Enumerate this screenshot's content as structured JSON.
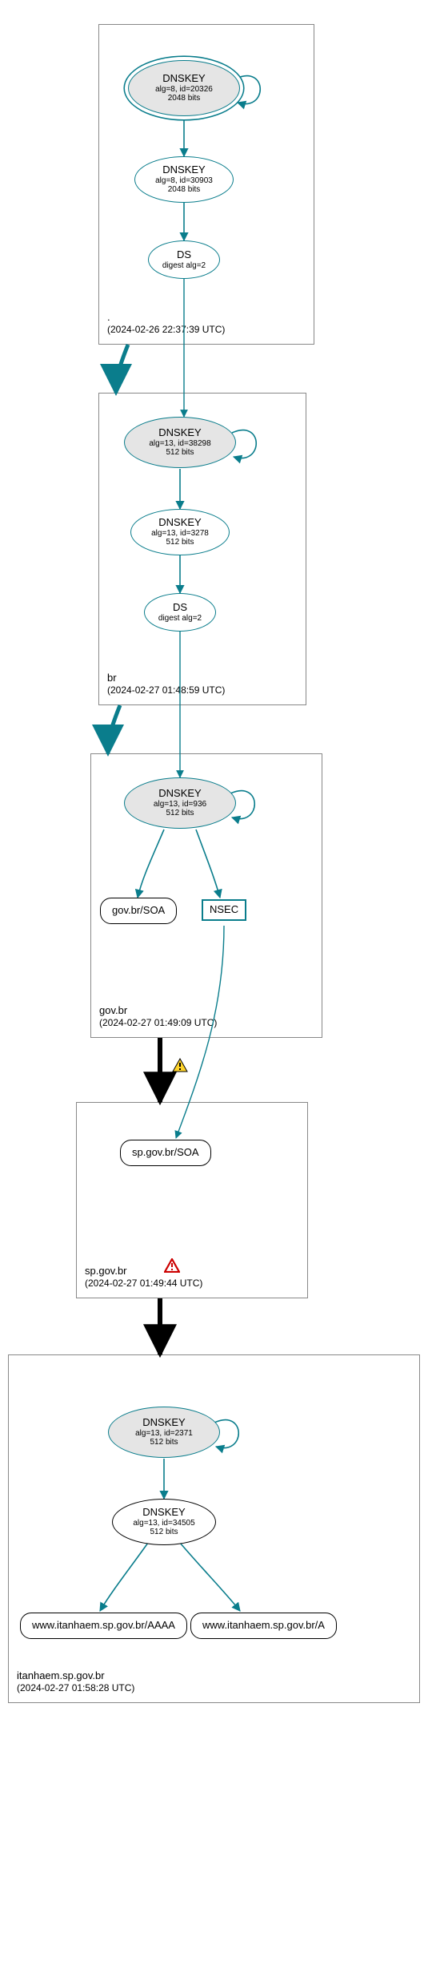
{
  "zones": [
    {
      "key": "root",
      "name": ".",
      "time": "(2024-02-26 22:37:39 UTC)"
    },
    {
      "key": "br",
      "name": "br",
      "time": "(2024-02-27 01:48:59 UTC)"
    },
    {
      "key": "govbr",
      "name": "gov.br",
      "time": "(2024-02-27 01:49:09 UTC)"
    },
    {
      "key": "sp",
      "name": "sp.gov.br",
      "time": "(2024-02-27 01:49:44 UTC)"
    },
    {
      "key": "itan",
      "name": "itanhaem.sp.gov.br",
      "time": "(2024-02-27 01:58:28 UTC)"
    }
  ],
  "nodes": {
    "root_ksk": {
      "title": "DNSKEY",
      "l1": "alg=8, id=20326",
      "l2": "2048 bits"
    },
    "root_zsk": {
      "title": "DNSKEY",
      "l1": "alg=8, id=30903",
      "l2": "2048 bits"
    },
    "root_ds": {
      "title": "DS",
      "l1": "digest alg=2"
    },
    "br_ksk": {
      "title": "DNSKEY",
      "l1": "alg=13, id=38298",
      "l2": "512 bits"
    },
    "br_zsk": {
      "title": "DNSKEY",
      "l1": "alg=13, id=3278",
      "l2": "512 bits"
    },
    "br_ds": {
      "title": "DS",
      "l1": "digest alg=2"
    },
    "gov_ksk": {
      "title": "DNSKEY",
      "l1": "alg=13, id=936",
      "l2": "512 bits"
    },
    "gov_soa": {
      "label": "gov.br/SOA"
    },
    "nsec": {
      "label": "NSEC"
    },
    "sp_soa": {
      "label": "sp.gov.br/SOA"
    },
    "itan_ksk": {
      "title": "DNSKEY",
      "l1": "alg=13, id=2371",
      "l2": "512 bits"
    },
    "itan_zsk": {
      "title": "DNSKEY",
      "l1": "alg=13, id=34505",
      "l2": "512 bits"
    },
    "itan_aaaa": {
      "label": "www.itanhaem.sp.gov.br/AAAA"
    },
    "itan_a": {
      "label": "www.itanhaem.sp.gov.br/A"
    }
  },
  "colors": {
    "teal": "#0a7d8c",
    "black": "#000000",
    "grayfill": "#e5e5e5"
  }
}
